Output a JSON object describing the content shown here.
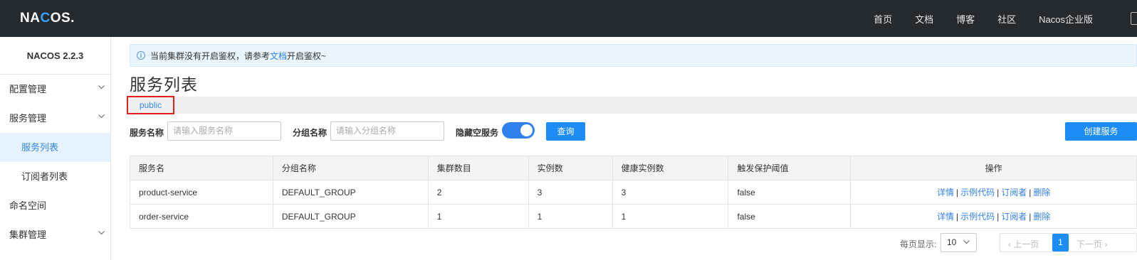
{
  "header": {
    "logo_pre": "NA",
    "logo_c": "C",
    "logo_post": "OS.",
    "nav": [
      "首页",
      "文档",
      "博客",
      "社区",
      "Nacos企业版"
    ]
  },
  "sidebar": {
    "version": "NACOS 2.2.3",
    "items": [
      {
        "label": "配置管理"
      },
      {
        "label": "服务管理"
      },
      {
        "label": "服务列表"
      },
      {
        "label": "订阅者列表"
      },
      {
        "label": "命名空间"
      },
      {
        "label": "集群管理"
      }
    ]
  },
  "notice": {
    "pre": "当前集群没有开启鉴权，请参考",
    "link": "文档",
    "post": "开启鉴权~"
  },
  "page_title": "服务列表",
  "namespace_tab": "public",
  "filters": {
    "service_label": "服务名称",
    "service_placeholder": "请输入服务名称",
    "group_label": "分组名称",
    "group_placeholder": "请输入分组名称",
    "hide_empty_label": "隐藏空服务",
    "hide_empty_on": true,
    "query_button": "查询",
    "create_button": "创建服务"
  },
  "table": {
    "headers": [
      "服务名",
      "分组名称",
      "集群数目",
      "实例数",
      "健康实例数",
      "触发保护阈值",
      "操作"
    ],
    "rows": [
      [
        "product-service",
        "DEFAULT_GROUP",
        "2",
        "3",
        "3",
        "false"
      ],
      [
        "order-service",
        "DEFAULT_GROUP",
        "1",
        "1",
        "1",
        "false"
      ]
    ],
    "ops": [
      "详情",
      "示例代码",
      "订阅者",
      "删除"
    ],
    "op_sep": "|"
  },
  "pager": {
    "per_page_label": "每页显示:",
    "per_page": "10",
    "prev": "上一页",
    "current": "1",
    "next": "下一页"
  },
  "colors": {
    "topbar": "#252a2f",
    "accent": "#1d8df5",
    "namespace_highlight": "#e02020"
  }
}
